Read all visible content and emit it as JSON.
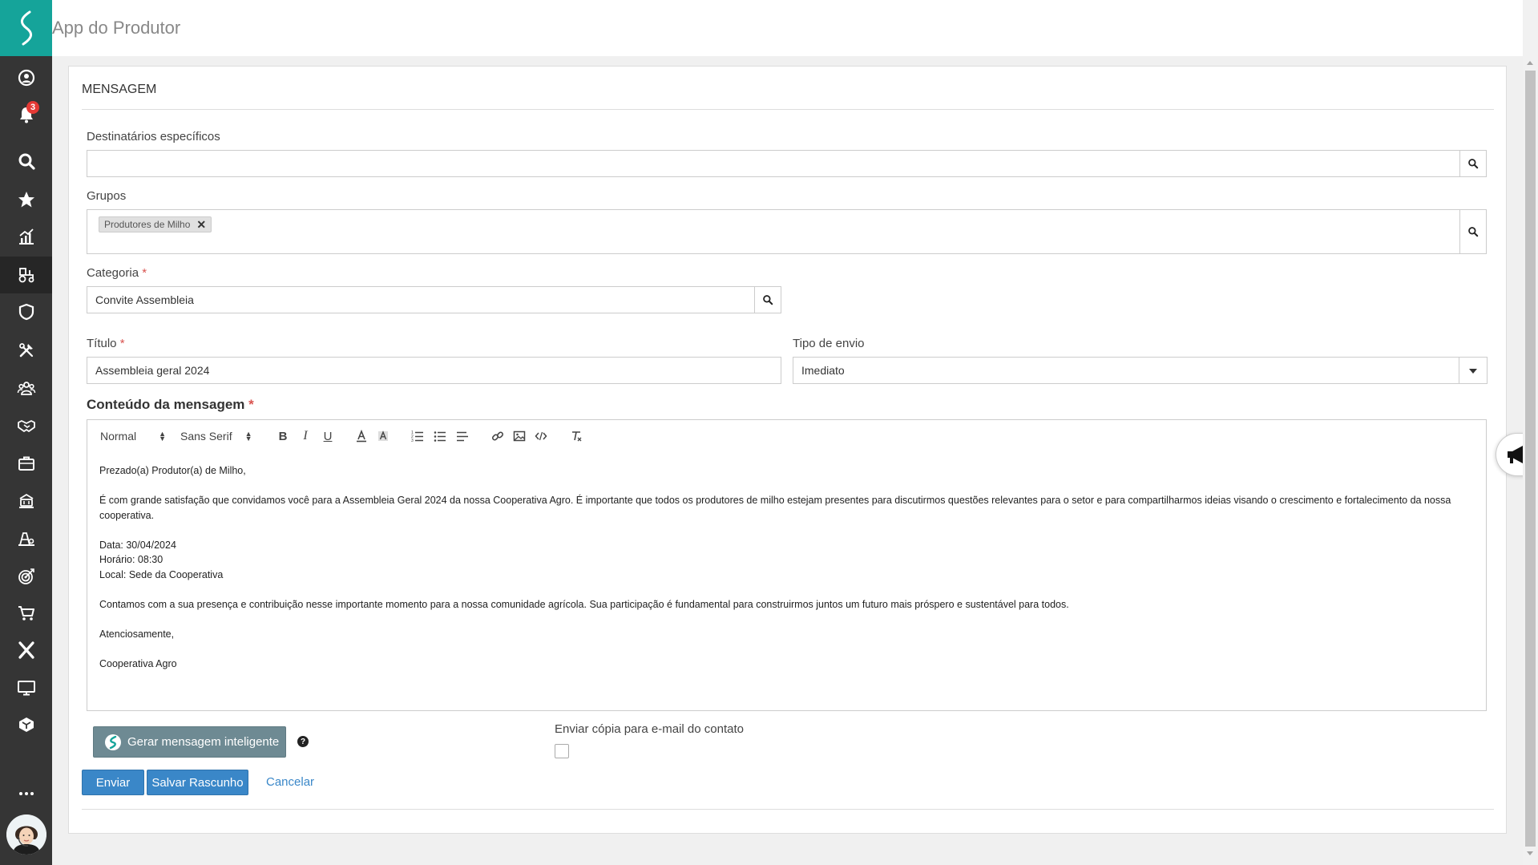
{
  "app": {
    "title": "App do Produtor"
  },
  "sidebar": {
    "notification_count": "3",
    "items": [
      {
        "icon": "user-circle-icon"
      },
      {
        "icon": "bell-icon"
      },
      {
        "icon": "search-icon"
      },
      {
        "icon": "star-icon"
      },
      {
        "icon": "chart-icon"
      },
      {
        "icon": "tractor-icon"
      },
      {
        "icon": "shield-icon"
      },
      {
        "icon": "tools-icon"
      },
      {
        "icon": "team-icon"
      },
      {
        "icon": "handshake-icon"
      },
      {
        "icon": "briefcase-icon"
      },
      {
        "icon": "bank-icon"
      },
      {
        "icon": "farm-icon"
      },
      {
        "icon": "target-icon"
      },
      {
        "icon": "cart-icon"
      },
      {
        "icon": "x-icon"
      },
      {
        "icon": "monitor-icon"
      },
      {
        "icon": "dropbox-icon"
      },
      {
        "icon": "more-icon"
      }
    ],
    "colors": {
      "bg": "#353535",
      "logo_bg": "#15a49a"
    }
  },
  "panel": {
    "title": "MENSAGEM"
  },
  "form": {
    "recipients": {
      "label": "Destinatários específicos",
      "value": ""
    },
    "groups": {
      "label": "Grupos",
      "tags": [
        "Produtores de Milho"
      ]
    },
    "category": {
      "label": "Categoria",
      "required": "*",
      "value": "Convite Assembleia"
    },
    "title": {
      "label": "Título",
      "required": "*",
      "value": "Assembleia geral 2024"
    },
    "send_type": {
      "label": "Tipo de envio",
      "value": "Imediato"
    },
    "content": {
      "label": "Conteúdo da mensagem",
      "required": "*",
      "toolbar": {
        "size": "Normal",
        "font": "Sans Serif"
      },
      "paragraphs": [
        "Prezado(a) Produtor(a) de Milho,",
        "",
        "É com grande satisfação que convidamos você para a Assembleia Geral 2024 da nossa Cooperativa Agro. É importante que todos os produtores de milho estejam presentes para discutirmos questões relevantes para o setor e para compartilharmos ideias visando o crescimento e fortalecimento da nossa cooperativa.",
        "",
        "Data: 30/04/2024",
        "Horário: 08:30",
        "Local: Sede da Cooperativa",
        "",
        "Contamos com a sua presença e contribuição nesse importante momento para a nossa comunidade agrícola. Sua participação é fundamental para construirmos juntos um futuro mais próspero e sustentável para todos.",
        "",
        "Atenciosamente,",
        "",
        "Cooperativa Agro"
      ]
    },
    "copy_email": {
      "label": "Enviar cópia para e-mail do contato",
      "checked": false
    }
  },
  "actions": {
    "ai_button": "Gerar mensagem inteligente",
    "help": "?",
    "send": "Enviar",
    "save_draft": "Salvar Rascunho",
    "cancel": "Cancelar"
  },
  "colors": {
    "primary": "#3a87c8",
    "ai_button": "#6e8a93",
    "required": "#d9534f"
  }
}
